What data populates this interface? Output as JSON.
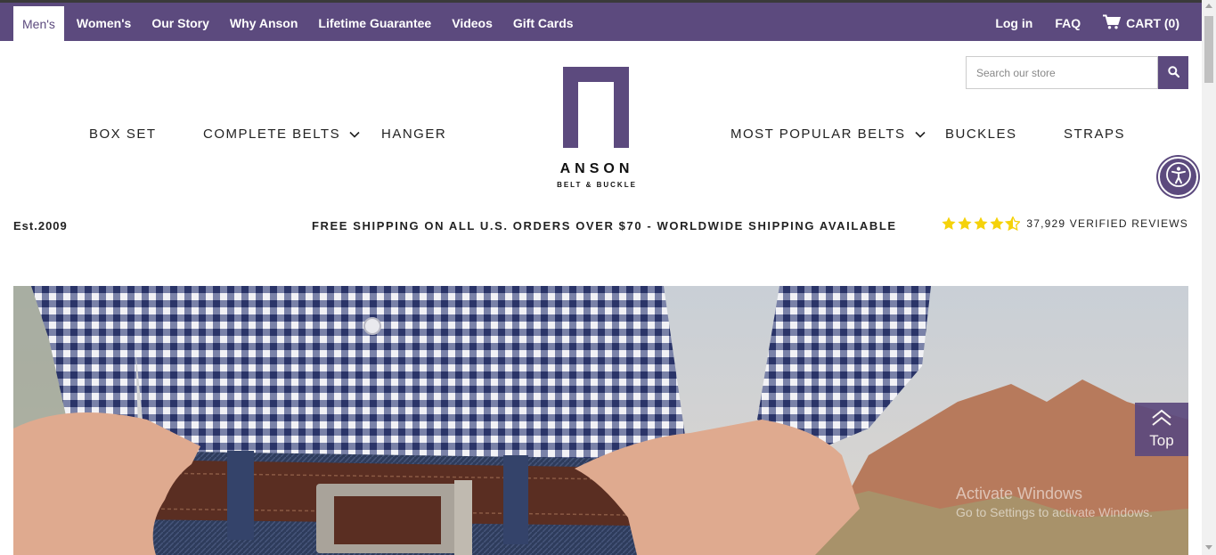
{
  "topbar": {
    "left_links": [
      "Men's",
      "Women's",
      "Our Story",
      "Why Anson",
      "Lifetime Guarantee",
      "Videos",
      "Gift Cards"
    ],
    "login": "Log in",
    "faq": "FAQ",
    "cart": "CART (0)"
  },
  "search": {
    "placeholder": "Search our store"
  },
  "nav": {
    "box_set": "BOX SET",
    "complete_belts": "COMPLETE BELTS",
    "hanger": "HANGER",
    "most_popular": "MOST POPULAR BELTS",
    "buckles": "BUCKLES",
    "straps": "STRAPS"
  },
  "logo": {
    "brand": "ANSON",
    "tagline": "BELT & BUCKLE"
  },
  "banner": {
    "est": "Est.2009",
    "shipping": "FREE SHIPPING ON ALL U.S. ORDERS OVER $70 - WORLDWIDE SHIPPING AVAILABLE",
    "rating": 4.5,
    "reviews": "37,929 VERIFIED REVIEWS"
  },
  "top_button": "Top",
  "watermark": {
    "line1": "Activate Windows",
    "line2": "Go to Settings to activate Windows."
  },
  "colors": {
    "brand_purple": "#5c4a7e",
    "star_yellow": "#f5d20a"
  },
  "icons": [
    "cart-icon",
    "search-icon",
    "chevron-down-icon",
    "accessibility-icon",
    "star-icon",
    "chevron-up-icon"
  ]
}
